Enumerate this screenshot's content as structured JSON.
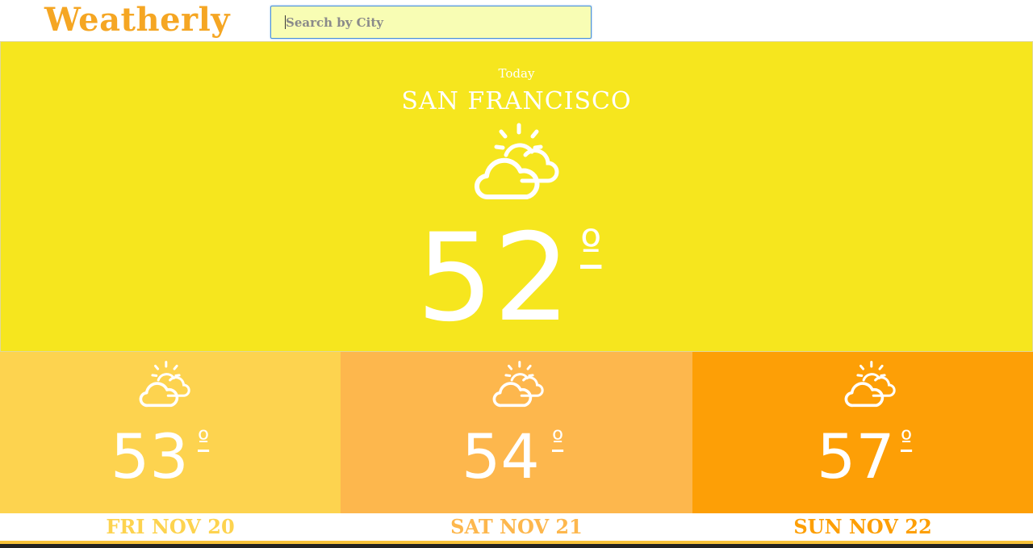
{
  "app": {
    "logo": "Weatherly"
  },
  "search": {
    "placeholder": "Search by City",
    "value": ""
  },
  "today": {
    "label": "Today",
    "city": "SAN FRANCISCO",
    "temp": "52",
    "degree_symbol": "º",
    "icon": "partly-cloudy-icon"
  },
  "forecast": [
    {
      "temp": "53",
      "degree_symbol": "º",
      "date": "FRI NOV 20",
      "icon": "partly-cloudy-icon",
      "color": "#fdd34f"
    },
    {
      "temp": "54",
      "degree_symbol": "º",
      "date": "SAT NOV 21",
      "icon": "partly-cloudy-icon",
      "color": "#fdb74d"
    },
    {
      "temp": "57",
      "degree_symbol": "º",
      "date": "SUN NOV 22",
      "icon": "partly-cloudy-icon",
      "color": "#fd9f06"
    }
  ],
  "colors": {
    "logo": "#f5a623",
    "today_bg": "#f6e61e",
    "search_bg": "#f8fdb4"
  }
}
